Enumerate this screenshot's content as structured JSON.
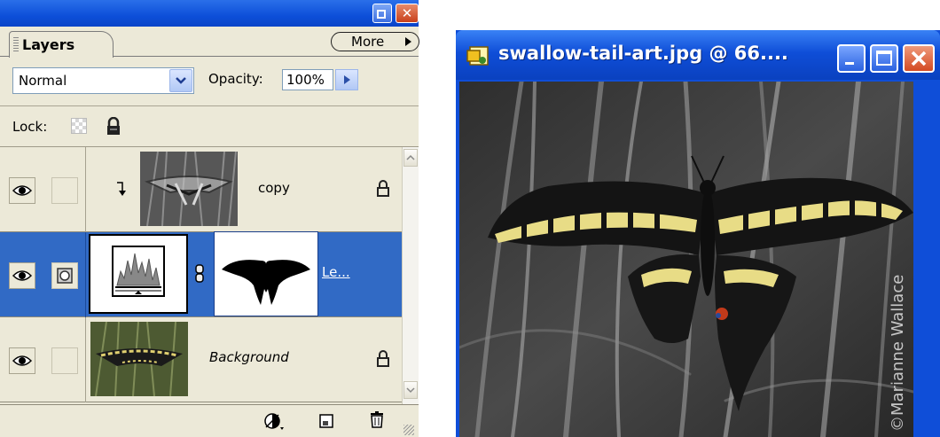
{
  "layers_palette": {
    "tab_label": "Layers",
    "more_label": "More",
    "blend_mode": "Normal",
    "opacity_label": "Opacity:",
    "opacity_value": "100%",
    "lock_label": "Lock:",
    "layers": [
      {
        "name": "copy",
        "visible": true,
        "clipped": true,
        "locked": true,
        "selected": false
      },
      {
        "name": "Le...",
        "visible": true,
        "type": "adjustment",
        "has_mask": true,
        "selected": true
      },
      {
        "name": "Background",
        "visible": true,
        "locked": true,
        "selected": false
      }
    ],
    "icons": {
      "eye": "eye-icon",
      "lock": "padlock-icon",
      "clip": "clip-arrow-icon",
      "chain": "chain-link-icon",
      "new_adjustment": "adjustment-layer-icon",
      "new_layer": "new-layer-icon",
      "trash": "trash-icon"
    }
  },
  "document": {
    "title": "swallow-tail-art.jpg @ 66....",
    "watermark": "©Marianne Wallace"
  },
  "colors": {
    "xp_blue": "#0f4ed8",
    "selection": "#316ac5",
    "palette_bg": "#ece9d8",
    "wing_yellow": "#e8dc86"
  }
}
